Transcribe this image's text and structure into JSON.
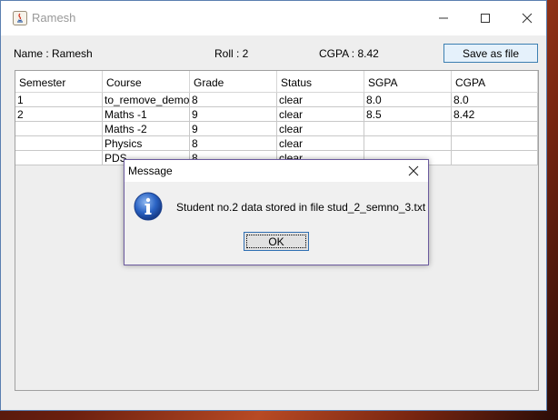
{
  "window": {
    "title": "Ramesh"
  },
  "info": {
    "name": "Name : Ramesh",
    "roll": "Roll : 2",
    "cgpa": "CGPA : 8.42",
    "save_label": "Save as file"
  },
  "table": {
    "headers": [
      "Semester",
      "Course",
      "Grade",
      "Status",
      "SGPA",
      "CGPA"
    ],
    "rows": [
      [
        "1",
        "to_remove_demo",
        "8",
        "clear",
        "8.0",
        "8.0"
      ],
      [
        "2",
        "Maths -1",
        "9",
        "clear",
        "8.5",
        "8.42"
      ],
      [
        "",
        "Maths -2",
        "9",
        "clear",
        "",
        ""
      ],
      [
        "",
        "Physics",
        "8",
        "clear",
        "",
        ""
      ],
      [
        "",
        "PDS",
        "8",
        "clear",
        "",
        ""
      ]
    ]
  },
  "dialog": {
    "title": "Message",
    "message": "Student no.2 data stored in file stud_2_semno_3.txt",
    "ok_label": "OK",
    "icon": "info-icon"
  }
}
